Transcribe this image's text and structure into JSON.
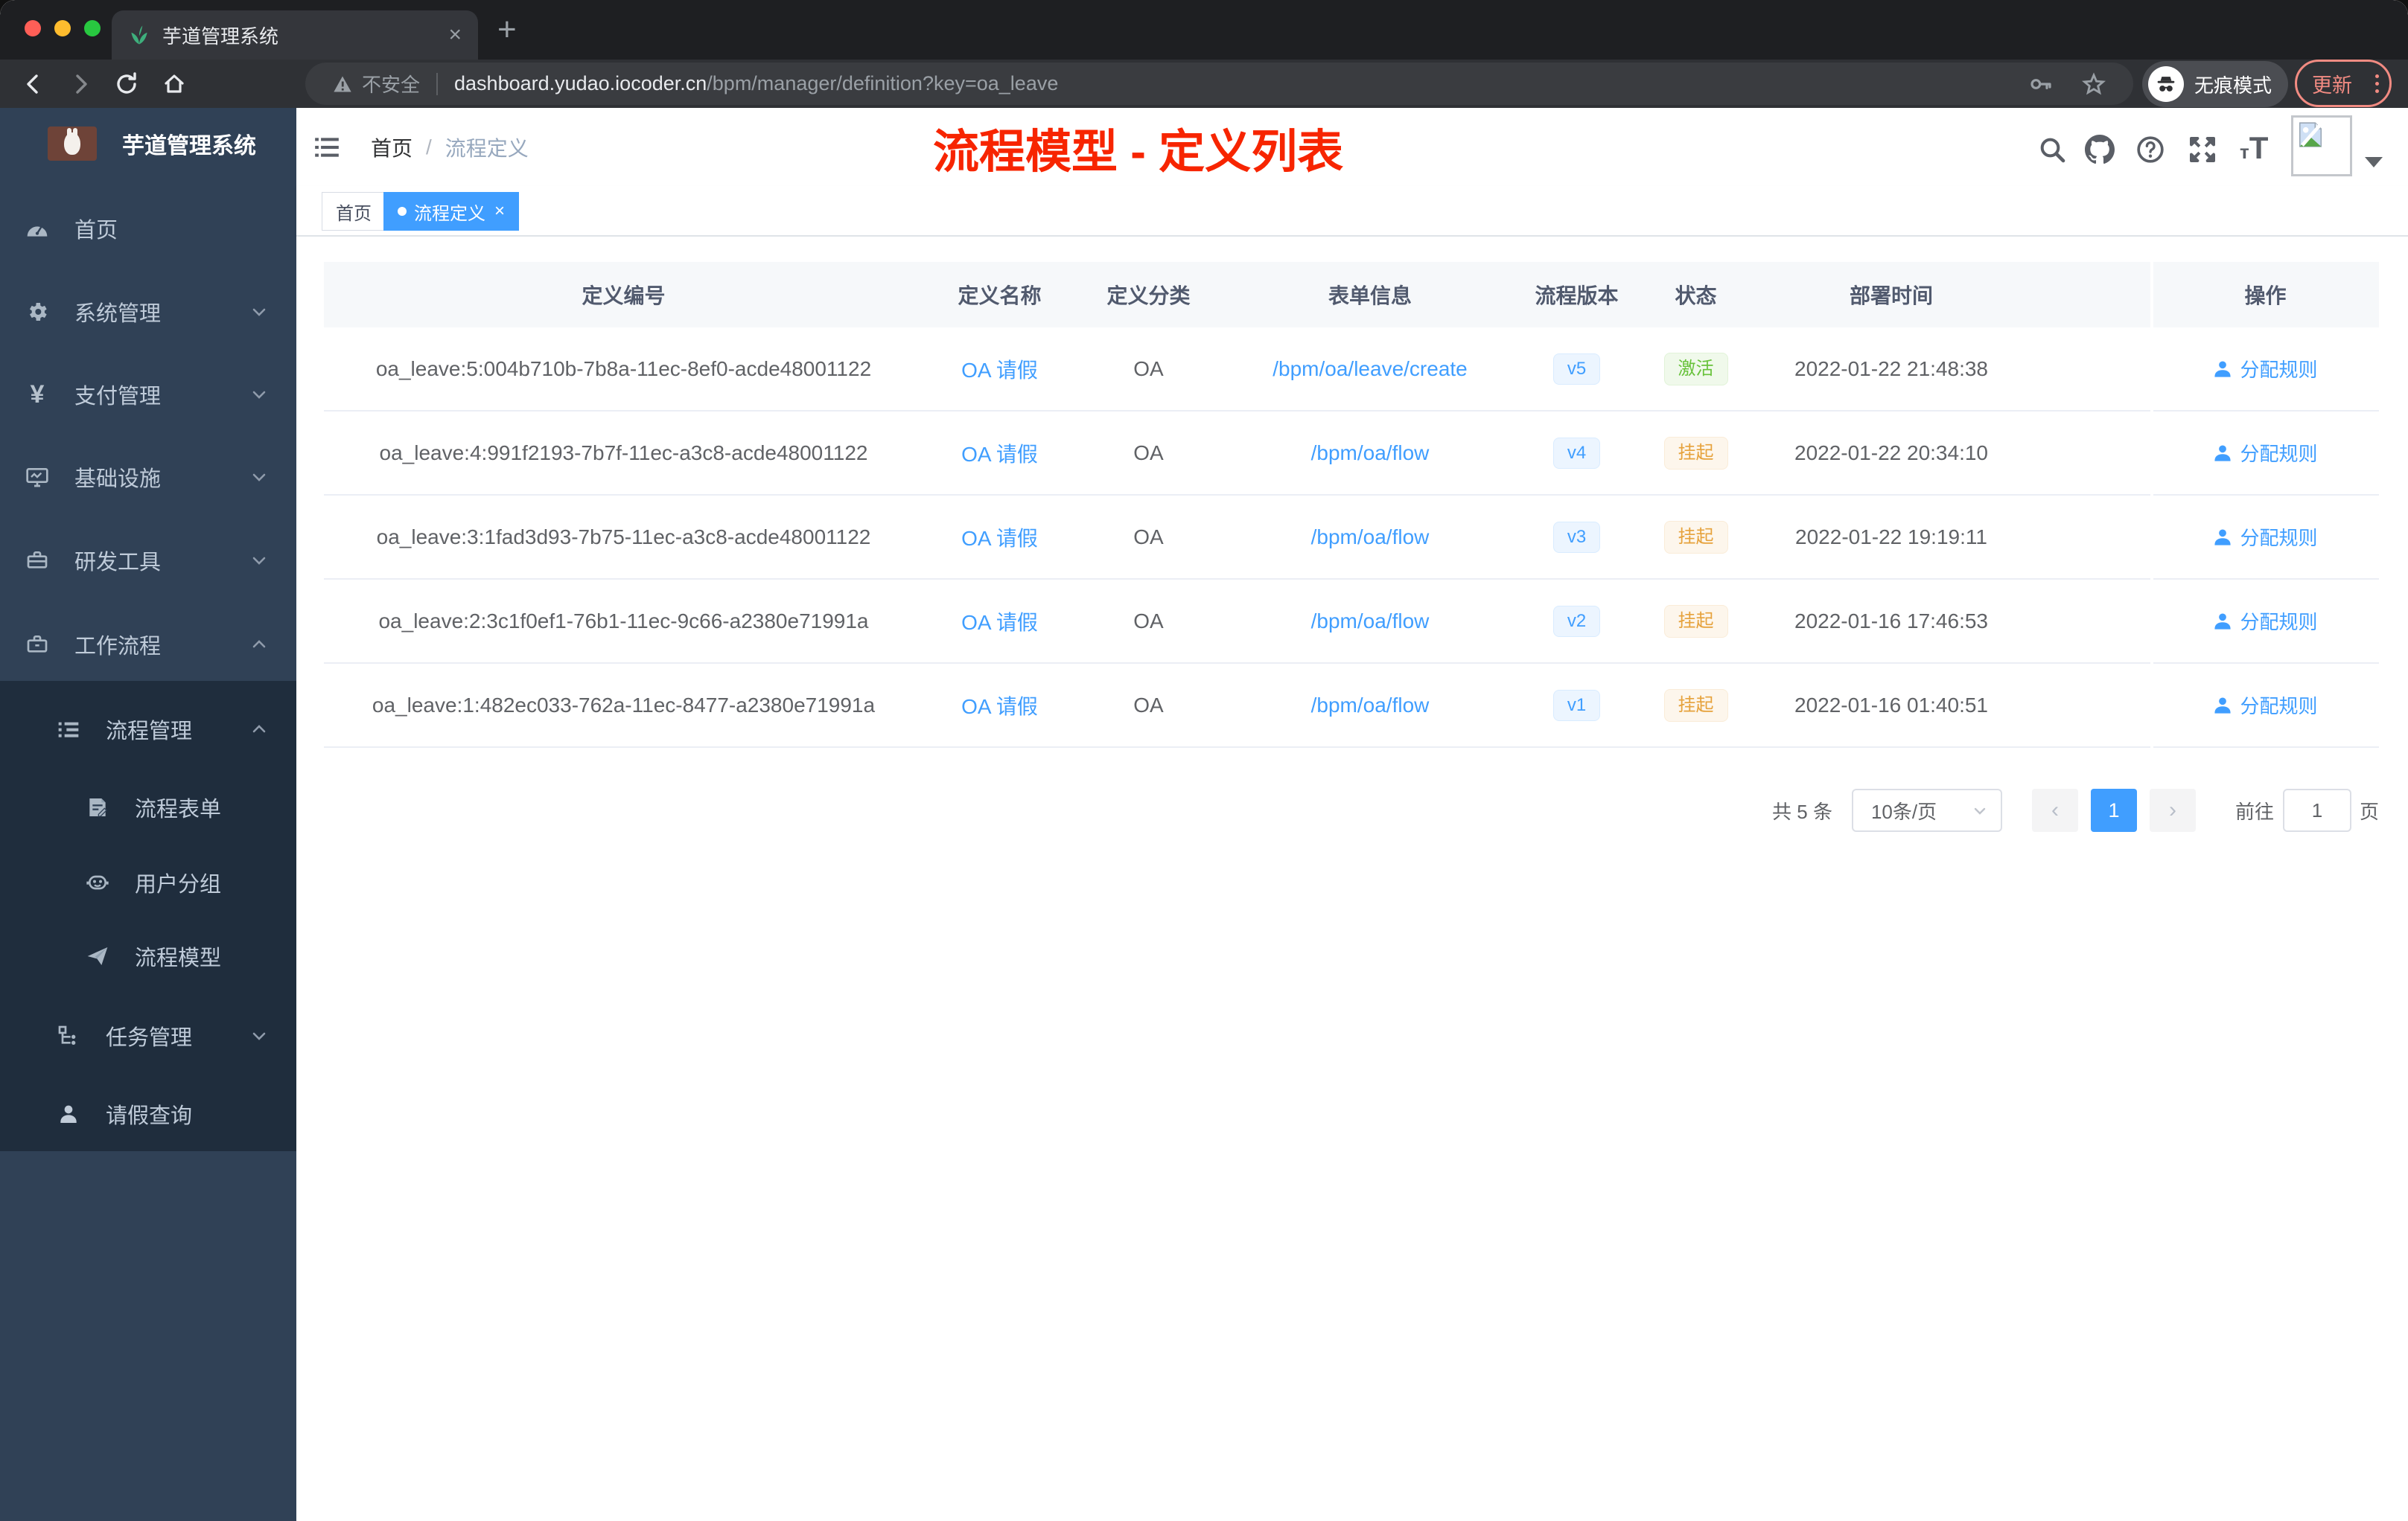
{
  "browser": {
    "tab_title": "芋道管理系统",
    "close_glyph": "×",
    "new_tab_glyph": "+",
    "security_label": "不安全",
    "url_host": "dashboard.yudao.iocoder.cn",
    "url_path": "/bpm/manager/definition?key=oa_leave",
    "incognito_label": "无痕模式",
    "update_label": "更新"
  },
  "sidebar": {
    "logo_title": "芋道管理系统",
    "items": [
      {
        "label": "首页",
        "icon": "dashboard-icon"
      },
      {
        "label": "系统管理",
        "icon": "gear-icon",
        "arrow": "down"
      },
      {
        "label": "支付管理",
        "icon": "yen-icon",
        "arrow": "down"
      },
      {
        "label": "基础设施",
        "icon": "monitor-icon",
        "arrow": "down"
      },
      {
        "label": "研发工具",
        "icon": "toolbox-icon",
        "arrow": "down"
      },
      {
        "label": "工作流程",
        "icon": "briefcase-icon",
        "arrow": "up"
      },
      {
        "label": "流程管理",
        "icon": "list-tree-icon",
        "arrow": "up"
      },
      {
        "label": "流程表单",
        "icon": "form-icon"
      },
      {
        "label": "用户分组",
        "icon": "robot-icon"
      },
      {
        "label": "流程模型",
        "icon": "paper-plane-icon"
      },
      {
        "label": "任务管理",
        "icon": "org-tree-icon",
        "arrow": "down"
      },
      {
        "label": "请假查询",
        "icon": "user-icon"
      }
    ]
  },
  "header": {
    "breadcrumb": [
      "首页",
      "流程定义"
    ],
    "breadcrumb_sep": "/",
    "annotation": "流程模型 - 定义列表",
    "icons": [
      "search-icon",
      "github-icon",
      "help-icon",
      "fullscreen-icon",
      "font-size-icon"
    ]
  },
  "tags": [
    {
      "label": "首页",
      "active": false
    },
    {
      "label": "流程定义",
      "active": true
    }
  ],
  "table": {
    "columns": [
      "定义编号",
      "定义名称",
      "定义分类",
      "表单信息",
      "流程版本",
      "状态",
      "部署时间",
      "操作"
    ],
    "action_label": "分配规则",
    "rows": [
      {
        "id": "oa_leave:5:004b710b-7b8a-11ec-8ef0-acde48001122",
        "name": "OA 请假",
        "category": "OA",
        "form": "/bpm/oa/leave/create",
        "version": "v5",
        "status": "激活",
        "status_type": "success",
        "time": "2022-01-22 21:48:38"
      },
      {
        "id": "oa_leave:4:991f2193-7b7f-11ec-a3c8-acde48001122",
        "name": "OA 请假",
        "category": "OA",
        "form": "/bpm/oa/flow",
        "version": "v4",
        "status": "挂起",
        "status_type": "warning",
        "time": "2022-01-22 20:34:10"
      },
      {
        "id": "oa_leave:3:1fad3d93-7b75-11ec-a3c8-acde48001122",
        "name": "OA 请假",
        "category": "OA",
        "form": "/bpm/oa/flow",
        "version": "v3",
        "status": "挂起",
        "status_type": "warning",
        "time": "2022-01-22 19:19:11"
      },
      {
        "id": "oa_leave:2:3c1f0ef1-76b1-11ec-9c66-a2380e71991a",
        "name": "OA 请假",
        "category": "OA",
        "form": "/bpm/oa/flow",
        "version": "v2",
        "status": "挂起",
        "status_type": "warning",
        "time": "2022-01-16 17:46:53"
      },
      {
        "id": "oa_leave:1:482ec033-762a-11ec-8477-a2380e71991a",
        "name": "OA 请假",
        "category": "OA",
        "form": "/bpm/oa/flow",
        "version": "v1",
        "status": "挂起",
        "status_type": "warning",
        "time": "2022-01-16 01:40:51"
      }
    ]
  },
  "pagination": {
    "total": "共 5 条",
    "page_size": "10条/页",
    "prev_glyph": "‹",
    "next_glyph": "›",
    "current": "1",
    "goto_label": "前往",
    "goto_value": "1",
    "unit_label": "页"
  },
  "colors": {
    "accent": "#409eff",
    "annotation_red": "#f72500",
    "update_coral": "#f28b82",
    "sidebar_bg": "#304156",
    "submenu_bg": "#1f2d3d",
    "status_active_text": "#67c23a",
    "status_active_bg": "#f0f9eb",
    "status_suspend_text": "#e6a23c",
    "status_suspend_bg": "#fdf6ec",
    "version_chip_text": "#409eff",
    "version_chip_bg": "#ecf5ff"
  }
}
